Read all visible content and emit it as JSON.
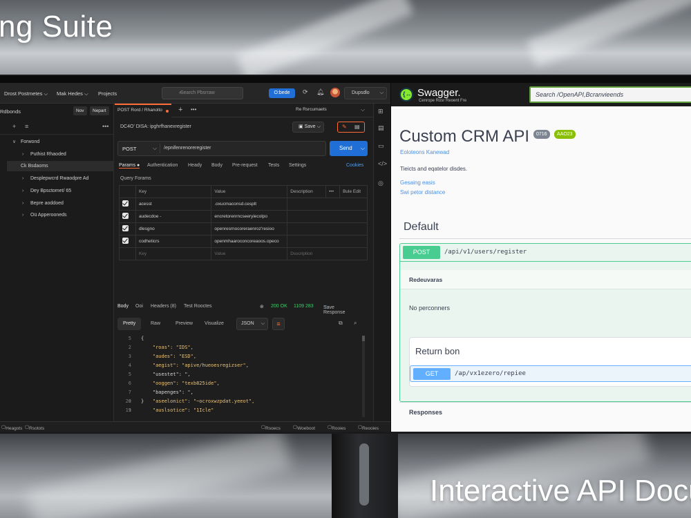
{
  "headline_top": "ng Suite",
  "headline_bottom": "Interactive API Docu",
  "postman": {
    "topbar": {
      "menu_workspaces": "Drost Postmetes",
      "menu_explore": "Mak Hedes",
      "menu_projects": "Projects",
      "search_placeholder": "Search Pbsrraw",
      "upgrade_label": "O:bede",
      "workspace_select": "Dupsdlo"
    },
    "sidebar": {
      "title": "Rdbonds",
      "new_button": "Nov",
      "import_button": "Nepart",
      "items": [
        {
          "label": "Forwond",
          "arrow": "∨"
        },
        {
          "label": "Puthist Rhaoded",
          "arrow": "›"
        },
        {
          "label": "Ck Bsdaoms",
          "arrow": ""
        },
        {
          "label": "Desplepwcrd Rwaodpre Ad",
          "arrow": "›"
        },
        {
          "label": "Dey Bpsctomet/ 65",
          "arrow": "›"
        },
        {
          "label": "Bepre aoddoed",
          "arrow": "›"
        },
        {
          "label": "Oü Apperooneds",
          "arrow": "›"
        }
      ]
    },
    "tab": {
      "active_label": "POST Rord / Rhanolto",
      "environment": "Re Rsrcumaets"
    },
    "request": {
      "breadcrumb": "DC4O' DISA: ipghrfhanexregister",
      "save_label": "Save",
      "method": "POST",
      "url": "/epnifenrenoreregister",
      "send_label": "Send",
      "tabs": [
        "Params ●",
        "Authentication",
        "Heady",
        "Body",
        "Pre-request",
        "Tests",
        "Settings"
      ],
      "cookies_label": "Cookies",
      "query_title": "Query Forams",
      "table_headers": [
        "Key",
        "Value",
        "Description",
        "•••",
        "Bule Edit"
      ],
      "params": [
        {
          "key": "acesst",
          "value": ".oxucmaconsd.cesplt"
        },
        {
          "key": "audecdoe -",
          "value": "encretorenrncseeryiecolpo"
        },
        {
          "key": "dlesgno",
          "value": "openresrnocoreraenroz'resioo"
        },
        {
          "key": "codheticrs",
          "value": "openmhaaroconcoreaoos.opeco"
        }
      ],
      "placeholder_key": "Key",
      "placeholder_value": "Value",
      "placeholder_desc": "Dsscription"
    },
    "response": {
      "tabs": [
        "Body",
        "Ooi",
        "Headers (8)",
        "Test Rooctes"
      ],
      "status": "200 OK",
      "time": "1109 283",
      "save_label": "Save Response",
      "view_tabs": [
        "Pretty",
        "Raw",
        "Preview",
        "Visualize"
      ],
      "format": "JSON",
      "lines": [
        {
          "n": "5",
          "t": "{"
        },
        {
          "n": "2",
          "t": "    \"roas\": \"IDS\","
        },
        {
          "n": "3",
          "t": "    \"audes\": \"ESD\","
        },
        {
          "n": "4",
          "t": "    \"aegist\": \"apive/hueoesregizser\","
        },
        {
          "n": "5",
          "t": "    \"usestet\": \","
        },
        {
          "n": "6",
          "t": "    \"ooggen\": \"texb825ide\","
        },
        {
          "n": "7",
          "t": "    \"bapenges\": \","
        },
        {
          "n": "8",
          "t": "    \"aseelonict\": \"~ocroxwzpdat.yeeot\","
        },
        {
          "n": "9",
          "t": "    \"auslsotice\": \"1Icle\""
        },
        {
          "n": "20",
          "t": "}"
        },
        {
          "n": "11",
          "t": ""
        }
      ]
    },
    "statusbar": {
      "left1": "Heagots",
      "left2": "Rsotots",
      "right1": "Rsoecs",
      "right2": "Woeboot",
      "right3": "Rooies",
      "right4": "Reooies"
    }
  },
  "swagger": {
    "brand": "Swagger.",
    "brand_sub": "Cenrope Rosr Reoent Fre",
    "search": "Search /OpenAPI,Bcranvieends",
    "title": "Custom CRM API",
    "version_badge": "0716",
    "oas_badge": "AAO23",
    "subtitle_link": "Eoloteons Kanewad",
    "description": "Tieicts and eqatelor disdes.",
    "link1": "Gesaing easis",
    "link2": "Swi petor distance",
    "section_default": "Default",
    "post": {
      "method": "POST",
      "path": "/api/v1/users/register",
      "params_title": "Redeuvaras",
      "no_params": "No perconners"
    },
    "return": {
      "title": "Return bon",
      "method": "GET",
      "path": "/ap/vx1ezero/repiee"
    },
    "responses_label": "Responses"
  }
}
